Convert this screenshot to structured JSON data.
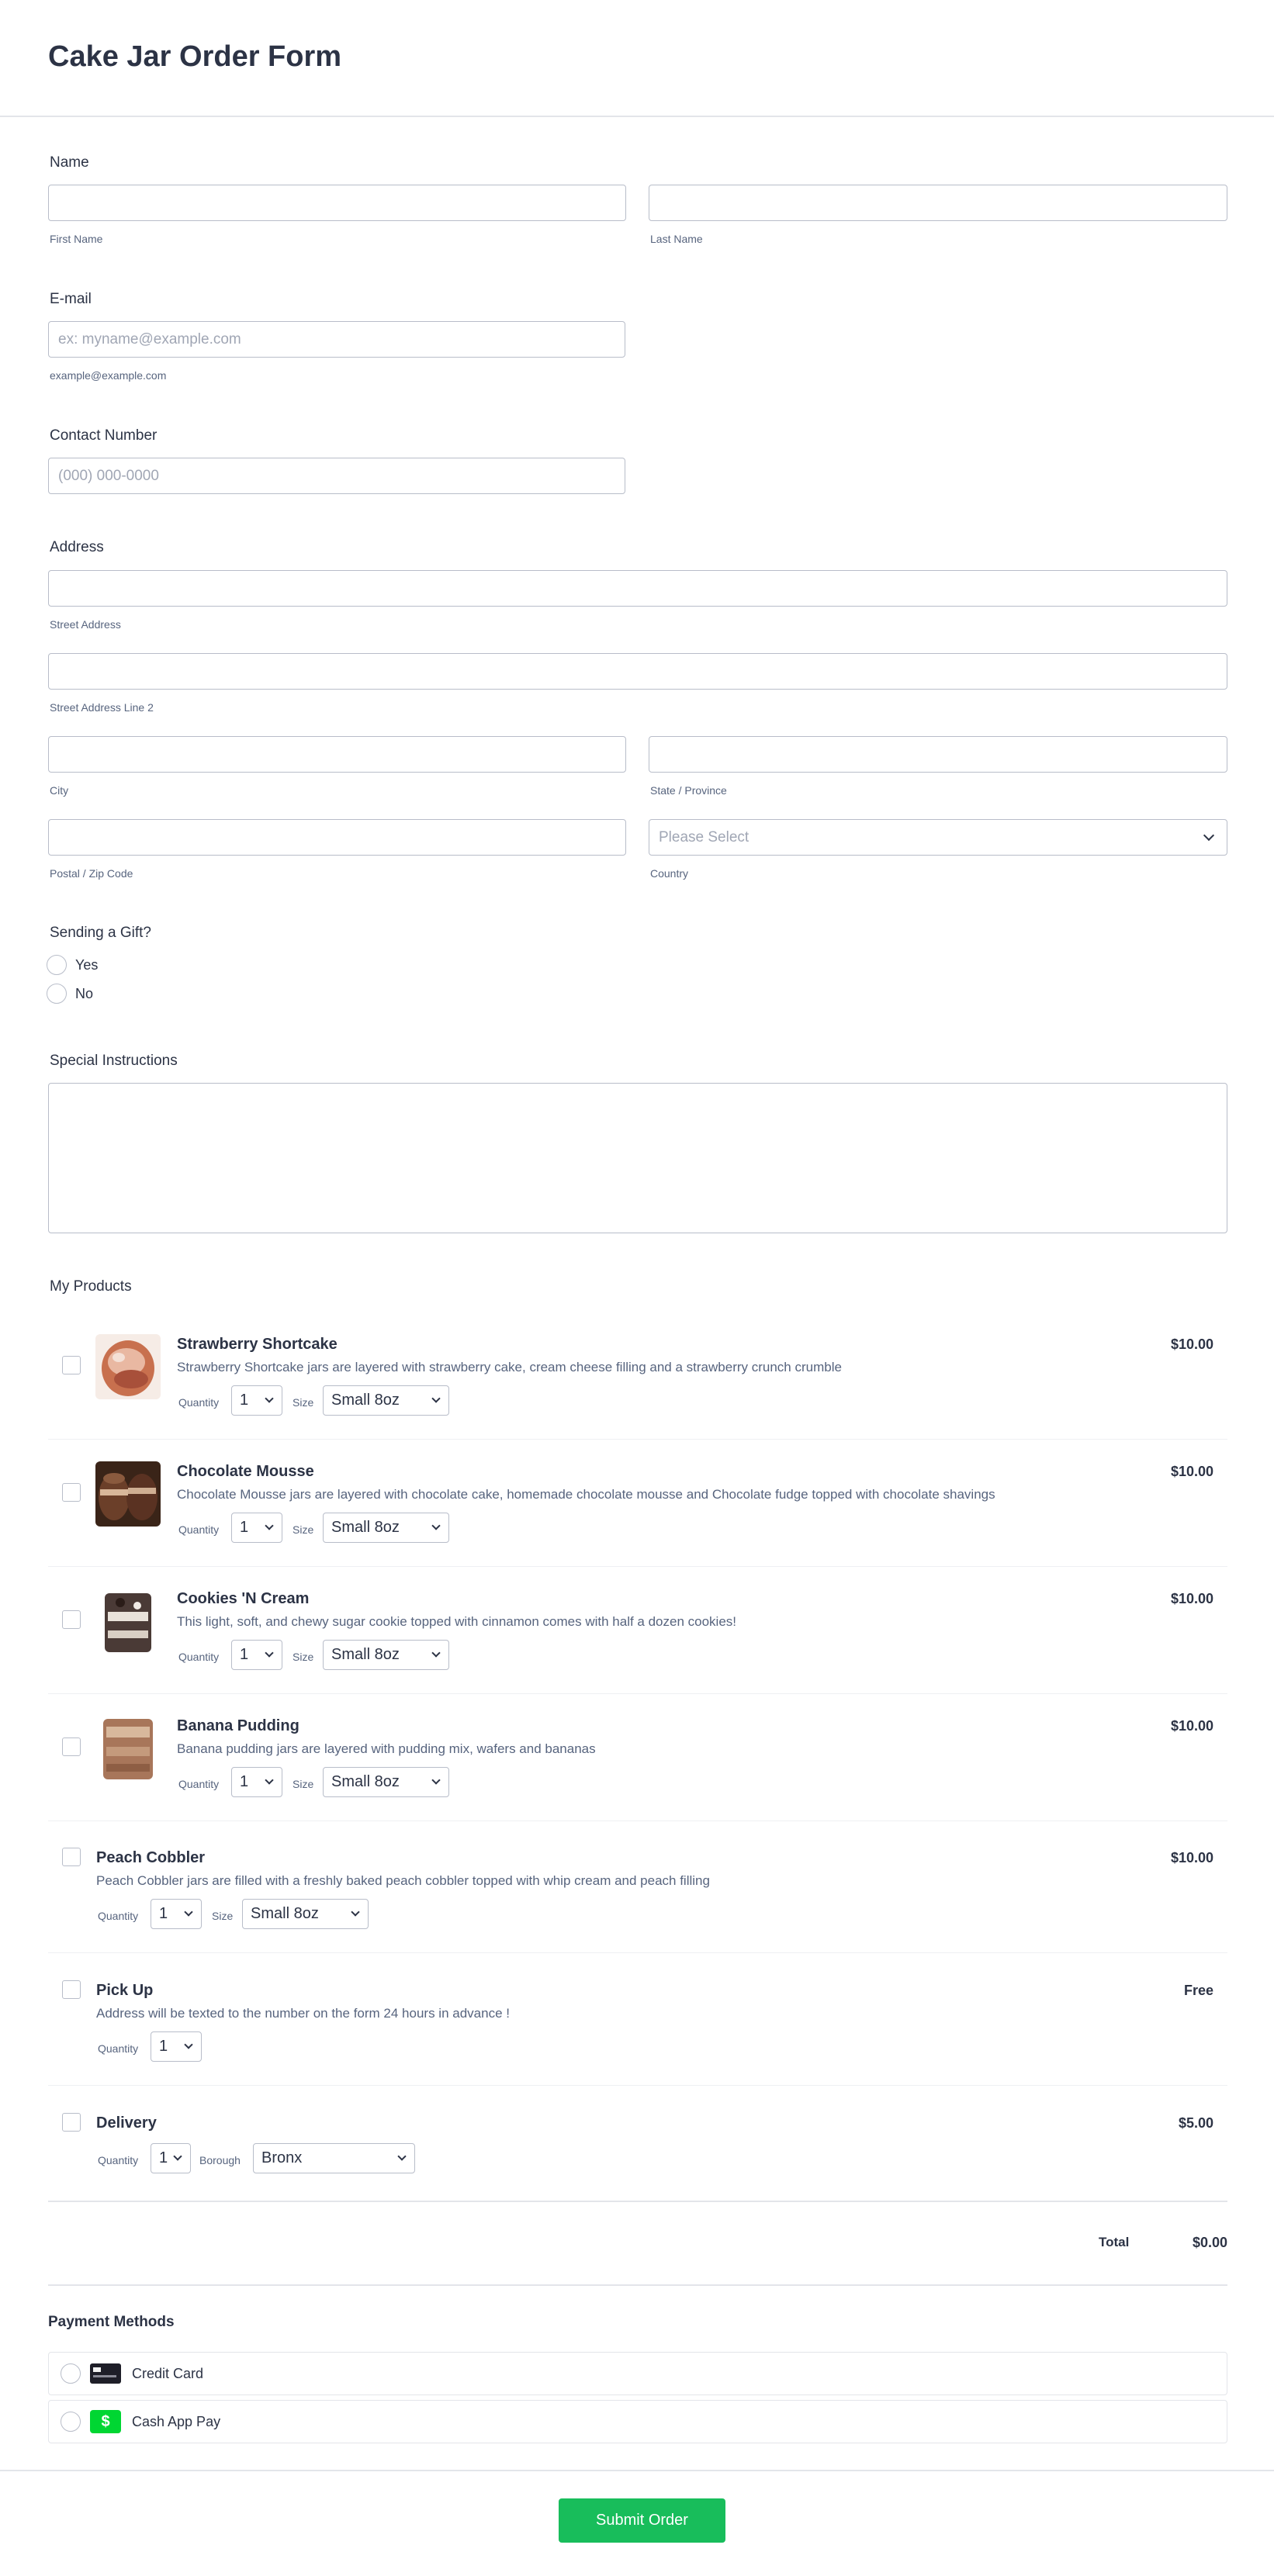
{
  "form": {
    "title": "Cake Jar Order Form"
  },
  "name": {
    "label": "Name",
    "first_label": "First Name",
    "last_label": "Last Name"
  },
  "email": {
    "label": "E-mail",
    "placeholder": "ex: myname@example.com",
    "sublabel": "example@example.com"
  },
  "contact": {
    "label": "Contact Number",
    "placeholder": "(000) 000-0000"
  },
  "address": {
    "label": "Address",
    "street_label": "Street Address",
    "street2_label": "Street Address Line 2",
    "city_label": "City",
    "state_label": "State / Province",
    "postal_label": "Postal / Zip Code",
    "country_label": "Country",
    "country_value": "Please Select"
  },
  "gift": {
    "label": "Sending a Gift?",
    "options": [
      "Yes",
      "No"
    ]
  },
  "instructions": {
    "label": "Special Instructions"
  },
  "products": {
    "label": "My Products",
    "quantity_label": "Quantity",
    "size_label": "Size",
    "borough_label": "Borough",
    "items": [
      {
        "name": "Strawberry Shortcake",
        "desc": "Strawberry Shortcake jars are layered with strawberry cake, cream cheese filling and a strawberry crunch crumble",
        "price": "$10.00",
        "quantity": "1",
        "size": "Small 8oz"
      },
      {
        "name": "Chocolate Mousse",
        "desc": "Chocolate Mousse jars are layered with chocolate cake, homemade chocolate mousse and Chocolate fudge topped with chocolate shavings",
        "price": "$10.00",
        "quantity": "1",
        "size": "Small 8oz"
      },
      {
        "name": "Cookies 'N Cream",
        "desc": "This light, soft, and chewy sugar cookie topped with cinnamon comes with half a dozen cookies!",
        "price": "$10.00",
        "quantity": "1",
        "size": "Small 8oz"
      },
      {
        "name": "Banana Pudding",
        "desc": "Banana pudding jars are layered with pudding mix, wafers and bananas",
        "price": "$10.00",
        "quantity": "1",
        "size": "Small 8oz"
      },
      {
        "name": "Peach Cobbler",
        "desc": "Peach Cobbler jars are filled with a freshly baked peach cobbler topped with whip cream and peach filling",
        "price": "$10.00",
        "quantity": "1",
        "size": "Small 8oz"
      },
      {
        "name": "Pick Up",
        "desc": "Address will be texted to the number on the form 24 hours in advance !",
        "price": "Free",
        "quantity": "1"
      },
      {
        "name": "Delivery",
        "price": "$5.00",
        "quantity": "1",
        "borough": "Bronx"
      }
    ],
    "total_label": "Total",
    "total_value": "$0.00"
  },
  "payment": {
    "label": "Payment Methods",
    "options": [
      {
        "label": "Credit Card",
        "icon": "credit-card-icon"
      },
      {
        "label": "Cash App Pay",
        "icon": "cash-app-icon",
        "icon_glyph": "$"
      }
    ]
  },
  "submit": {
    "label": "Submit Order"
  },
  "colors": {
    "accent": "#18bd5b",
    "text": "#2c3345",
    "muted": "#57647e",
    "border": "#b8bdc9",
    "cash_app": "#00d632"
  }
}
